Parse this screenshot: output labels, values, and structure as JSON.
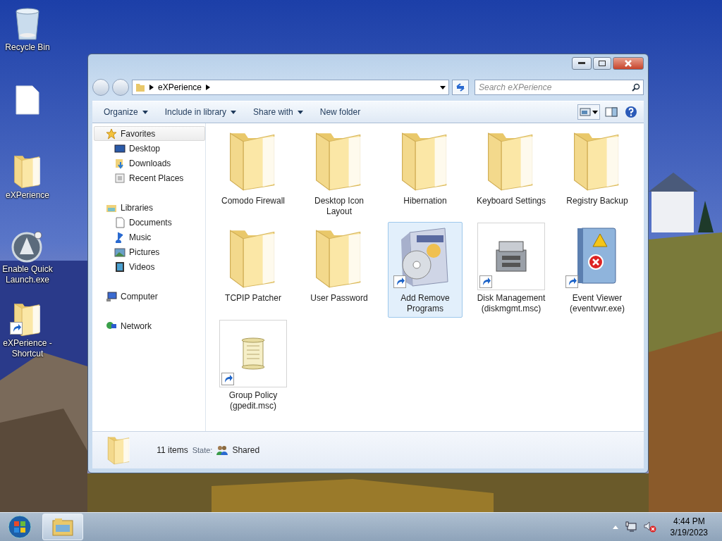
{
  "desktop_icons": [
    {
      "kind": "recycle",
      "label": "Recycle Bin",
      "shortcut": false
    },
    {
      "kind": "document",
      "shortcut": false
    },
    {
      "kind": "folder",
      "label": "eXPerience",
      "shortcut": false
    },
    {
      "kind": "app",
      "label": "Enable Quick Launch.exe",
      "shortcut": false
    },
    {
      "kind": "folder",
      "label": "eXPerience - Shortcut",
      "shortcut": true
    }
  ],
  "window": {
    "address": [
      "eXPerience"
    ],
    "search": {
      "placeholder": "Search eXPerience"
    },
    "toolbar": [
      {
        "label": "Organize",
        "dropdown": true
      },
      {
        "label": "Include in library",
        "dropdown": true
      },
      {
        "label": "Share with",
        "dropdown": true
      },
      {
        "label": "New folder",
        "dropdown": false
      }
    ],
    "nav": [
      {
        "kind": "favorites",
        "label": "Favorites",
        "selected": true,
        "children": [
          {
            "kind": "desktop",
            "label": "Desktop",
            "selected": false
          },
          {
            "kind": "downloads",
            "label": "Downloads",
            "selected": false
          },
          {
            "kind": "recent",
            "label": "Recent Places",
            "selected": false
          }
        ]
      },
      {
        "kind": "libraries",
        "label": "Libraries",
        "selected": false,
        "children": [
          {
            "kind": "documents",
            "label": "Documents",
            "selected": false
          },
          {
            "kind": "music",
            "label": "Music",
            "selected": false
          },
          {
            "kind": "pictures",
            "label": "Pictures",
            "selected": false
          },
          {
            "kind": "videos",
            "label": "Videos",
            "selected": false
          }
        ]
      },
      {
        "kind": "computer",
        "label": "Computer",
        "selected": false
      },
      {
        "kind": "network",
        "label": "Network",
        "selected": false
      }
    ],
    "items": [
      {
        "kind": "folder",
        "label": "Comodo Firewall",
        "shortcut": false,
        "selected": false
      },
      {
        "kind": "folder",
        "label": "Desktop Icon Layout",
        "shortcut": false,
        "selected": false
      },
      {
        "kind": "folder",
        "label": "Hibernation",
        "shortcut": false,
        "selected": false
      },
      {
        "kind": "folder",
        "label": "Keyboard Settings",
        "shortcut": false,
        "selected": false
      },
      {
        "kind": "folder",
        "label": "Registry Backup",
        "shortcut": false,
        "selected": false
      },
      {
        "kind": "folder",
        "label": "TCPIP Patcher",
        "shortcut": false,
        "selected": false
      },
      {
        "kind": "folder",
        "label": "User Password",
        "shortcut": false,
        "selected": false
      },
      {
        "kind": "installer",
        "label": "Add Remove Programs",
        "shortcut": true,
        "selected": true
      },
      {
        "kind": "disk",
        "label": "Disk Management (diskmgmt.msc)",
        "shortcut": true,
        "selected": false
      },
      {
        "kind": "eventlog",
        "label": "Event Viewer (eventvwr.exe)",
        "shortcut": true,
        "selected": false
      },
      {
        "kind": "scroll",
        "label": "Group Policy (gpedit.msc)",
        "shortcut": true,
        "selected": false
      }
    ],
    "details": {
      "count": "11 items",
      "state_label": "State:",
      "state": "Shared"
    }
  },
  "taskbar": {
    "time": "4:44 PM",
    "date": "3/19/2023"
  }
}
